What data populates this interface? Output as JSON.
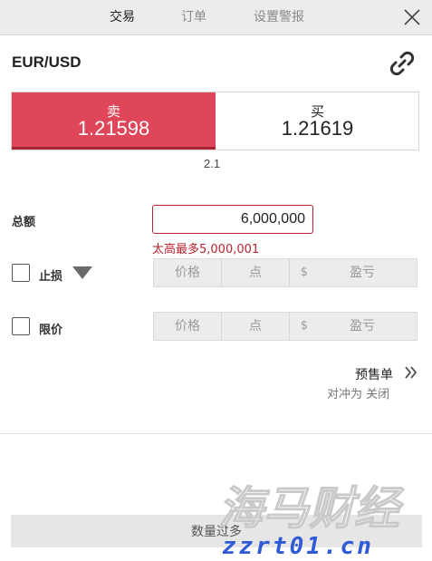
{
  "tabs": {
    "trade": "交易",
    "orders": "订单",
    "alerts": "设置警报"
  },
  "instrument": {
    "symbol": "EUR/USD"
  },
  "quote": {
    "sell_label": "卖",
    "sell_price": "1.21598",
    "buy_label": "买",
    "buy_price": "1.21619",
    "spread": "2.1"
  },
  "amount": {
    "label": "总额",
    "value": "6,000,000",
    "error": "太高最多5,000,001"
  },
  "stop_loss": {
    "label": "止损",
    "price_placeholder": "价格",
    "points_placeholder": "点",
    "currency_symbol": "$",
    "pnl_placeholder": "盈亏"
  },
  "limit": {
    "label": "限价",
    "price_placeholder": "价格",
    "points_placeholder": "点",
    "currency_symbol": "$",
    "pnl_placeholder": "盈亏"
  },
  "preorder": {
    "label": "预售单",
    "hedge_text": "对冲为 关闭"
  },
  "submit": {
    "label": "数量过多"
  },
  "watermark": {
    "brand": "海马财经",
    "domain": "zzrt01.cn"
  },
  "colors": {
    "sell": "#e0465a",
    "error": "#b8232f"
  },
  "icons": [
    "close-icon",
    "link-icon",
    "dropdown-triangle-icon",
    "double-chevron-right-icon"
  ]
}
